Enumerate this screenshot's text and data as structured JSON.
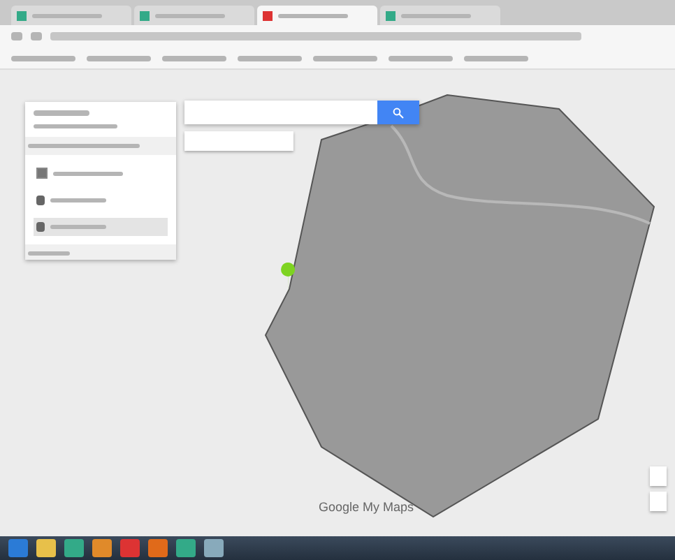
{
  "browser": {
    "tabs": [
      {
        "selected": false
      },
      {
        "selected": false
      },
      {
        "selected": true
      },
      {
        "selected": false
      }
    ]
  },
  "panel": {
    "layers": [
      {
        "checked": true,
        "items": [
          {
            "selected": false
          },
          {
            "selected": true
          }
        ]
      }
    ]
  },
  "map": {
    "logo": "Google My Maps"
  }
}
